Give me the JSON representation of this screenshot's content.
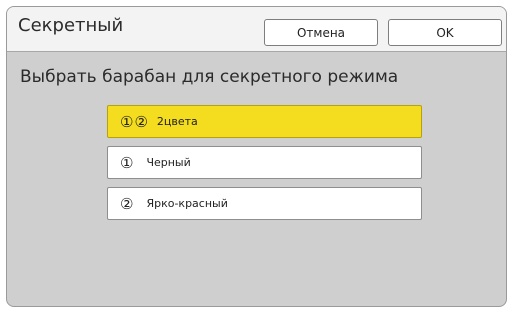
{
  "header": {
    "title": "Секретный",
    "cancel_label": "Отмена",
    "ok_label": "OK"
  },
  "main": {
    "prompt": "Выбрать барабан для секретного режима",
    "options": [
      {
        "icon": "①②",
        "label": "2цвета",
        "selected": true
      },
      {
        "icon": "①",
        "label": "Черный",
        "selected": false
      },
      {
        "icon": "②",
        "label": "Ярко-красный",
        "selected": false
      }
    ]
  },
  "colors": {
    "selected_background": "#f4dc1e",
    "panel_background": "#cfcfcf",
    "titlebar_background": "#f3f3f3"
  }
}
